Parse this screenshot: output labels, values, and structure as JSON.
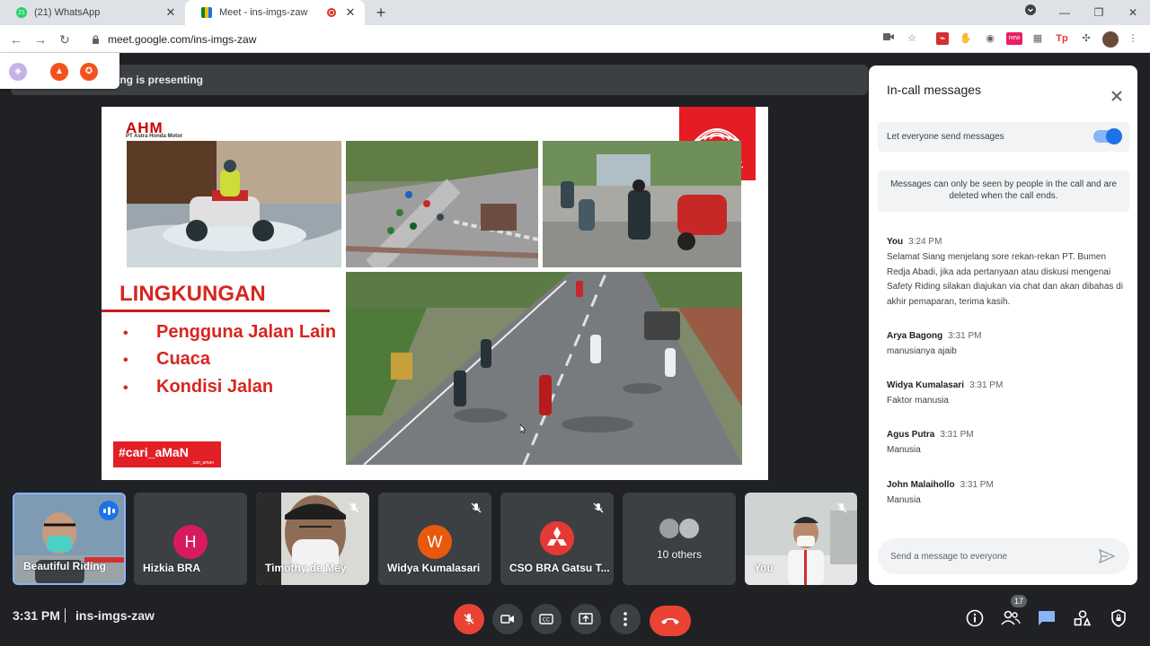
{
  "browser": {
    "tabs": [
      {
        "label": "(21) WhatsApp",
        "badge": "21",
        "active": false
      },
      {
        "label": "Meet - ins-imgs-zaw",
        "active": true
      }
    ],
    "url": "meet.google.com/ins-imgs-zaw",
    "extension_badge": "new"
  },
  "meet": {
    "presenting_text": "ing is presenting",
    "slide": {
      "brand": "AHM",
      "brand_sub": "PT Astra Honda Motor",
      "honda_name": "HONDA",
      "honda_tagline": "One HEART.",
      "heading": "LINGKUNGAN",
      "bullets": [
        "Pengguna Jalan Lain",
        "Cuaca",
        "Kondisi Jalan"
      ],
      "campaign": "#cari_aMaN",
      "campaign_sub": "cari_aman"
    },
    "participants": [
      {
        "name": "Beautiful Riding",
        "speaking": true
      },
      {
        "name": "Hizkia BRA",
        "initial": "H",
        "color": "#d81b60"
      },
      {
        "name": "Timothy de Mey",
        "muted": true
      },
      {
        "name": "Widya Kumalasari",
        "initial": "W",
        "color": "#e8590c",
        "muted": true
      },
      {
        "name": "CSO BRA Gatsu T...",
        "muted": true
      },
      {
        "name": "10 others"
      },
      {
        "name": "You",
        "muted": true
      }
    ],
    "bottom": {
      "time": "3:31 PM",
      "meeting_code": "ins-imgs-zaw",
      "people_count": "17"
    }
  },
  "chat": {
    "title": "In-call messages",
    "toggle_label": "Let everyone send messages",
    "info": "Messages can only be seen by people in the call and are deleted when the call ends.",
    "messages": [
      {
        "sender": "You",
        "time": "3:24 PM",
        "text": "Selamat Siang menjelang sore rekan-rekan PT. Bumen Redja Abadi, jika ada pertanyaan atau diskusi mengenai Safety Riding silakan diajukan via chat dan akan dibahas di akhir pemaparan, terima kasih."
      },
      {
        "sender": "Arya Bagong",
        "time": "3:31 PM",
        "text": "manusianya ajaib"
      },
      {
        "sender": "Widya Kumalasari",
        "time": "3:31 PM",
        "text": "Faktor manusia"
      },
      {
        "sender": "Agus Putra",
        "time": "3:31 PM",
        "text": "Manusia"
      },
      {
        "sender": "John Malaihollo",
        "time": "3:31 PM",
        "text": "Manusia"
      }
    ],
    "input_placeholder": "Send a message to everyone"
  }
}
